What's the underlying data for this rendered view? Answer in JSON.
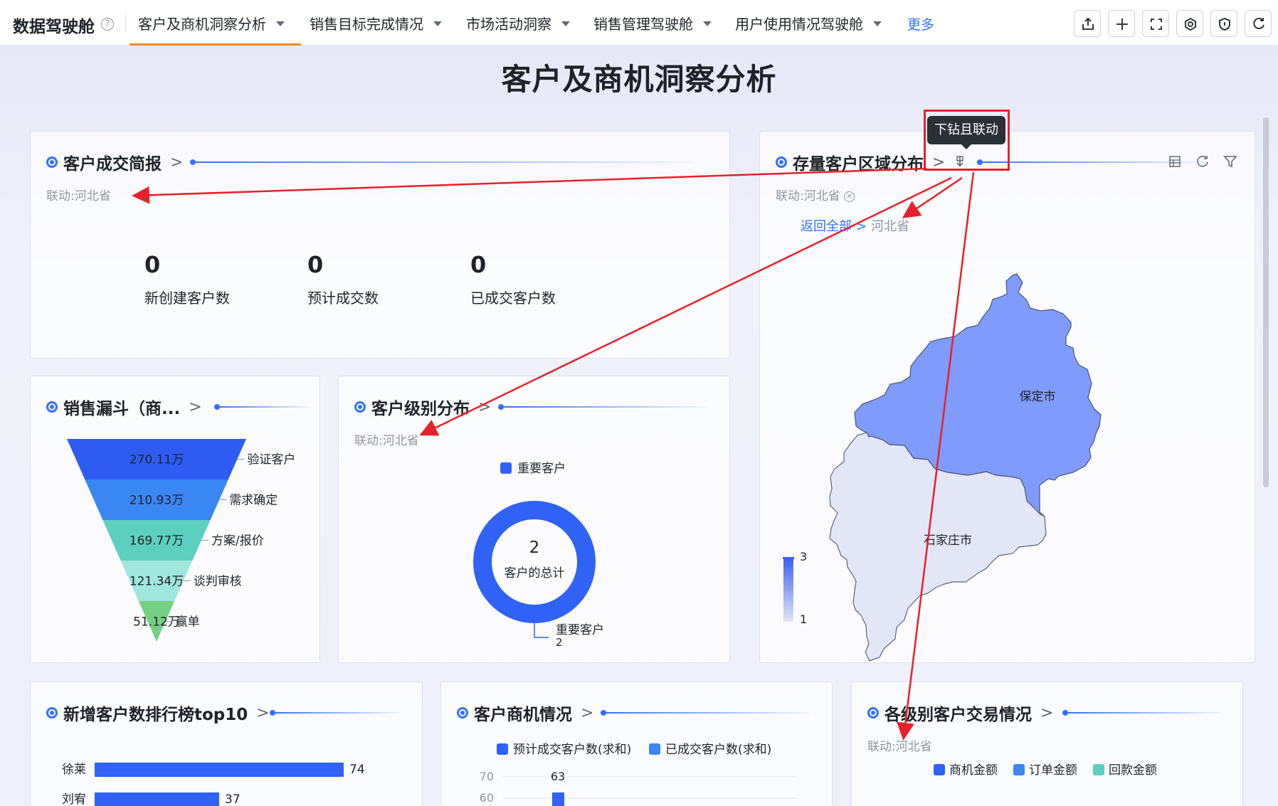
{
  "app": {
    "title": "数据驾驶舱",
    "help": "?"
  },
  "nav": {
    "tabs": [
      {
        "label": "客户及商机洞察分析",
        "active": true
      },
      {
        "label": "销售目标完成情况"
      },
      {
        "label": "市场活动洞察"
      },
      {
        "label": "销售管理驾驶舱"
      },
      {
        "label": "用户使用情况驾驶舱"
      }
    ],
    "more": "更多",
    "toolbar": [
      "share-icon",
      "plus-icon",
      "fullscreen-icon",
      "settings-icon",
      "shield-icon",
      "refresh-icon"
    ]
  },
  "dashboard": {
    "title": "客户及商机洞察分析"
  },
  "tooltip": "下钻且联动",
  "deal_summary": {
    "title": "客户成交简报",
    "linkage": "联动:河北省",
    "kpis": [
      {
        "value": "0",
        "label": "新创建客户数"
      },
      {
        "value": "0",
        "label": "预计成交数"
      },
      {
        "value": "0",
        "label": "已成交客户数"
      }
    ]
  },
  "region_map": {
    "title": "存量客户区域分布",
    "linkage": "联动:河北省",
    "breadcrumb": {
      "back": "返回全部",
      "sep": ">",
      "current": "河北省"
    },
    "regions": [
      {
        "name": "保定市",
        "value": 3,
        "color": "#7f9bfb"
      },
      {
        "name": "石家庄市",
        "value": 1,
        "color": "#e3e6f6"
      }
    ],
    "legend": {
      "max": "3",
      "min": "1"
    }
  },
  "funnel": {
    "title": "销售漏斗（商...",
    "chart_data": {
      "type": "funnel",
      "stages": [
        {
          "name": "验证客户",
          "value": "270.11万",
          "color": "#2f5cf0"
        },
        {
          "name": "需求确定",
          "value": "210.93万",
          "color": "#3a86f2"
        },
        {
          "name": "方案/报价",
          "value": "169.77万",
          "color": "#5ccfc0"
        },
        {
          "name": "谈判审核",
          "value": "121.34万",
          "color": "#9fe6dc"
        },
        {
          "name": "赢单",
          "value": "51.12万",
          "color": "#74d183"
        }
      ]
    }
  },
  "customer_level": {
    "title": "客户级别分布",
    "linkage": "联动:河北省",
    "chart_data": {
      "type": "pie",
      "legend": [
        "重要客户"
      ],
      "slices": [
        {
          "name": "重要客户",
          "value": 2,
          "color": "#2f62f5"
        }
      ],
      "total_value": "2",
      "total_label": "客户的总计",
      "label_name": "重要客户",
      "label_value": "2"
    }
  },
  "new_customer_rank": {
    "title": "新增客户数排行榜top10",
    "chart_data": {
      "type": "bar",
      "categories": [
        "徐莱",
        "刘宥"
      ],
      "values": [
        74,
        37
      ],
      "max": 74
    }
  },
  "opportunity": {
    "title": "客户商机情况",
    "chart_data": {
      "type": "bar",
      "series": [
        {
          "name": "预计成交客户数(求和)",
          "color": "#2f62f5"
        },
        {
          "name": "已成交客户数(求和)",
          "color": "#3a86f2"
        }
      ],
      "y_ticks": [
        "70",
        "60"
      ],
      "bar_label": "63"
    }
  },
  "level_transaction": {
    "title": "各级别客户交易情况",
    "linkage": "联动:河北省",
    "chart_data": {
      "type": "bar",
      "series": [
        {
          "name": "商机金额",
          "color": "#2f62f5"
        },
        {
          "name": "订单金额",
          "color": "#3a86f2"
        },
        {
          "name": "回款金额",
          "color": "#5ccfc0"
        }
      ]
    }
  }
}
